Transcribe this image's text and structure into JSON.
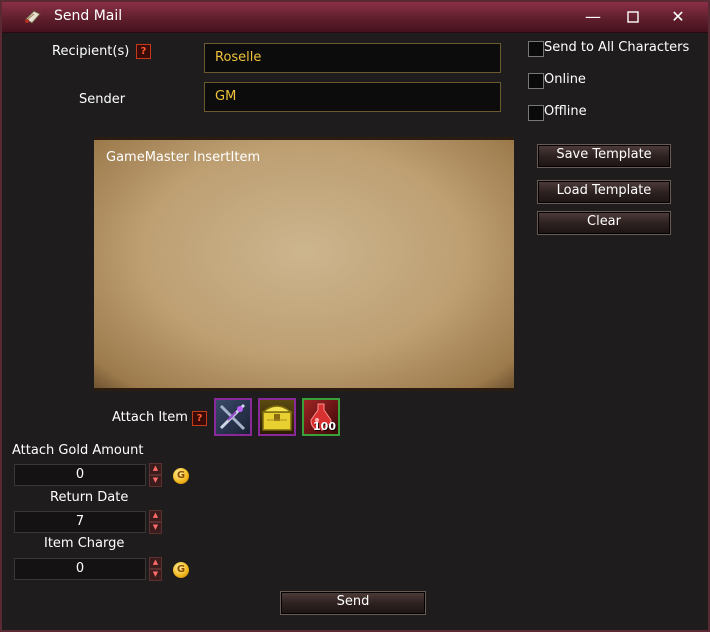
{
  "window": {
    "title": "Send Mail",
    "minimize_icon": "minimize-icon",
    "maximize_icon": "maximize-icon",
    "close_icon": "close-icon"
  },
  "form": {
    "recipient_label": "Recipient(s)",
    "recipient_value": "Roselle",
    "sender_label": "Sender",
    "sender_value": "GM",
    "help_glyph": "?"
  },
  "options": {
    "send_to_all": "Send to All Characters",
    "online": "Online",
    "offline": "Offline"
  },
  "message": {
    "body": "GameMaster InsertItem"
  },
  "template_buttons": {
    "save": "Save Template",
    "load": "Load Template",
    "clear": "Clear"
  },
  "attach": {
    "label": "Attach Item",
    "items": [
      {
        "icon": "crossed-weapons-icon",
        "border": "#8a2a9a"
      },
      {
        "icon": "treasure-chest-icon",
        "border": "#8a2a9a"
      },
      {
        "icon": "red-potion-icon",
        "border": "#3aa03a",
        "count": "100"
      }
    ]
  },
  "gold": {
    "label": "Attach Gold Amount",
    "value": "0",
    "coin_glyph": "G"
  },
  "return_date": {
    "label": "Return Date",
    "value": "7"
  },
  "item_charge": {
    "label": "Item Charge",
    "value": "0",
    "coin_glyph": "G"
  },
  "send_button": "Send",
  "colors": {
    "title_bar": "#7a2a3c",
    "value_text": "#f0c23c",
    "background": "#1e1c1c"
  }
}
